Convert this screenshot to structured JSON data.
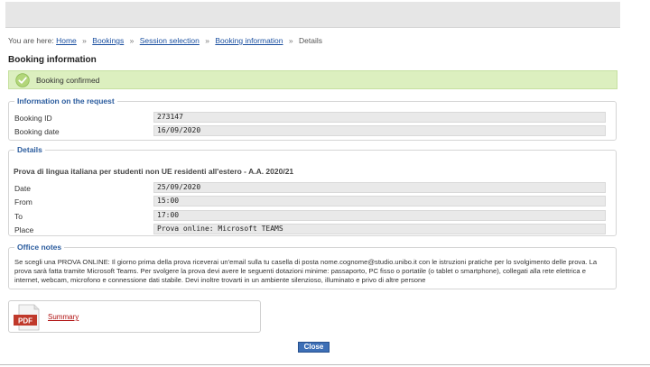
{
  "breadcrumb": {
    "prefix": "You are here:",
    "items": [
      "Home",
      "Bookings",
      "Session selection",
      "Booking information"
    ],
    "current": "Details",
    "separator": "»"
  },
  "page_title": "Booking information",
  "confirmation": {
    "text": "Booking confirmed",
    "color": "#dcefbf"
  },
  "request_info": {
    "legend": "Information on the request",
    "rows": [
      {
        "label": "Booking ID",
        "value": "273147"
      },
      {
        "label": "Booking date",
        "value": "16/09/2020"
      }
    ]
  },
  "details": {
    "legend": "Details",
    "heading": "Prova di lingua italiana per studenti non UE residenti all'estero - A.A. 2020/21",
    "rows": [
      {
        "label": "Date",
        "value": "25/09/2020"
      },
      {
        "label": "From",
        "value": "15:00"
      },
      {
        "label": "To",
        "value": "17:00"
      },
      {
        "label": "Place",
        "value": "Prova online: Microsoft TEAMS"
      }
    ]
  },
  "office_notes": {
    "legend": "Office notes",
    "text": "Se scegli una PROVA ONLINE: Il giorno prima della prova riceverai un'email sulla tu casella di posta nome.cognome@studio.unibo.it con le istruzioni pratiche per lo svolgimento delle prova. La prova sarà fatta tramite Microsoft Teams. Per svolgere la prova devi avere le seguenti dotazioni minime: passaporto, PC fisso o portatile (o tablet o smartphone), collegati alla rete elettrica e internet, webcam, microfono e connessione dati stabile. Devi inoltre trovarti in un ambiente silenzioso, illuminato e privo di altre persone"
  },
  "attachment": {
    "icon_label": "PDF",
    "link": "Summary"
  },
  "close_label": "Close",
  "colors": {
    "accent": "#2b5c9e",
    "link": "#1a4fa0",
    "button": "#3d6fb6",
    "pdf_red": "#c0392b"
  }
}
